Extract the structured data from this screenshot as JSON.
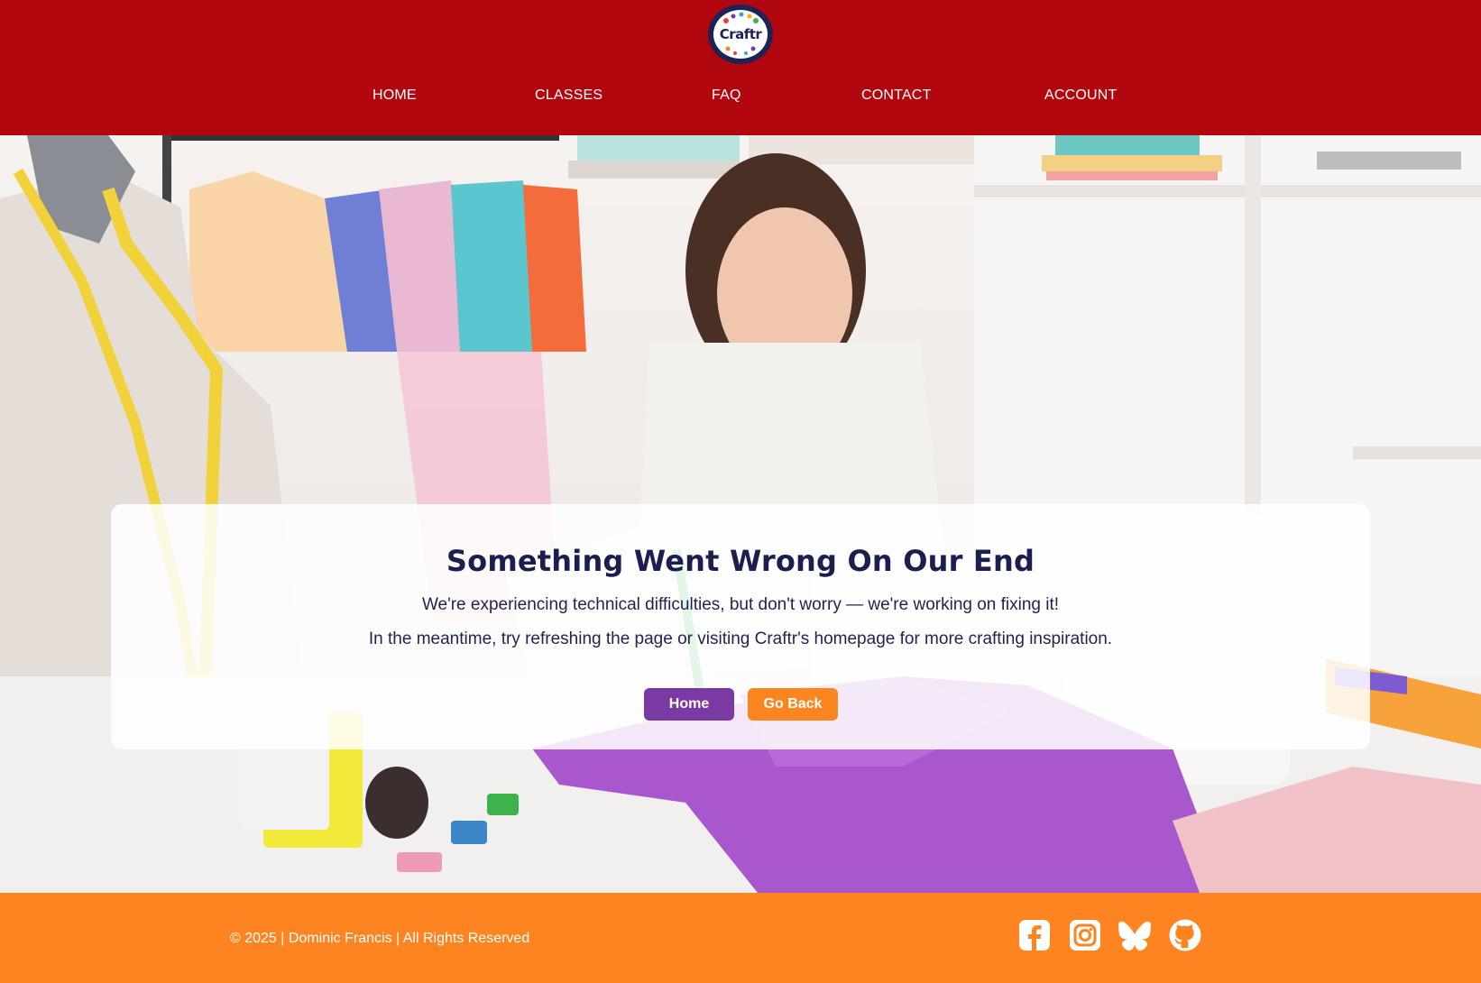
{
  "header": {
    "logo_text": "Craftr",
    "nav": [
      {
        "label": "HOME"
      },
      {
        "label": "CLASSES"
      },
      {
        "label": "FAQ"
      },
      {
        "label": "CONTACT"
      },
      {
        "label": "ACCOUNT"
      }
    ]
  },
  "error_card": {
    "title": "Something Went Wrong On Our End",
    "message_1": "We're experiencing technical difficulties, but don't worry — we're working on fixing it!",
    "message_2": "In the meantime, try refreshing the page or visiting Craftr's homepage for more crafting inspiration.",
    "home_button": "Home",
    "back_button": "Go Back"
  },
  "footer": {
    "copyright": "© 2025 | Dominic Francis | All Rights Reserved",
    "social_icons": [
      "facebook-icon",
      "instagram-icon",
      "bluesky-icon",
      "github-icon"
    ]
  },
  "colors": {
    "header_bg": "#b3070f",
    "footer_bg": "#fd8421",
    "title": "#1a1f4f",
    "home_button": "#7b3aa3",
    "back_button": "#fb8620"
  }
}
